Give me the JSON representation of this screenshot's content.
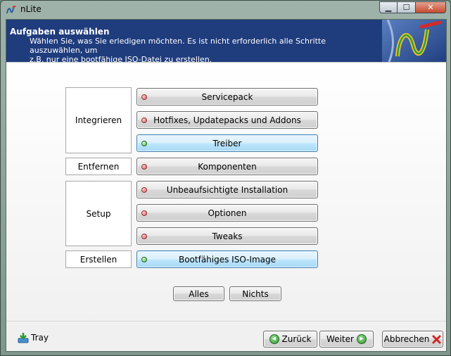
{
  "window": {
    "title": "nLite"
  },
  "header": {
    "title": "Aufgaben auswählen",
    "desc_line1": "Wählen Sie, was Sie erledigen möchten. Es ist nicht erforderlich alle Schritte auszuwählen, um",
    "desc_line2": "z.B. nur eine bootfähige ISO-Datei zu erstellen."
  },
  "groups": {
    "integrieren": "Integrieren",
    "entfernen": "Entfernen",
    "setup": "Setup",
    "erstellen": "Erstellen"
  },
  "tasks": [
    {
      "label": "Servicepack",
      "selected": false
    },
    {
      "label": "Hotfixes, Updatepacks und Addons",
      "selected": false
    },
    {
      "label": "Treiber",
      "selected": true
    },
    {
      "label": "Komponenten",
      "selected": false
    },
    {
      "label": "Unbeaufsichtigte Installation",
      "selected": false
    },
    {
      "label": "Optionen",
      "selected": false
    },
    {
      "label": "Tweaks",
      "selected": false
    },
    {
      "label": "Bootfähiges ISO-Image",
      "selected": true
    }
  ],
  "select": {
    "all": "Alles",
    "none": "Nichts"
  },
  "footer": {
    "tray": "Tray",
    "back": "Zurück",
    "next": "Weiter",
    "cancel": "Abbrechen"
  },
  "colors": {
    "banner": "#1f3c7d",
    "led_off": "#e04a4a",
    "led_on": "#3fae3f",
    "selected_btn": "#bee6fd"
  }
}
